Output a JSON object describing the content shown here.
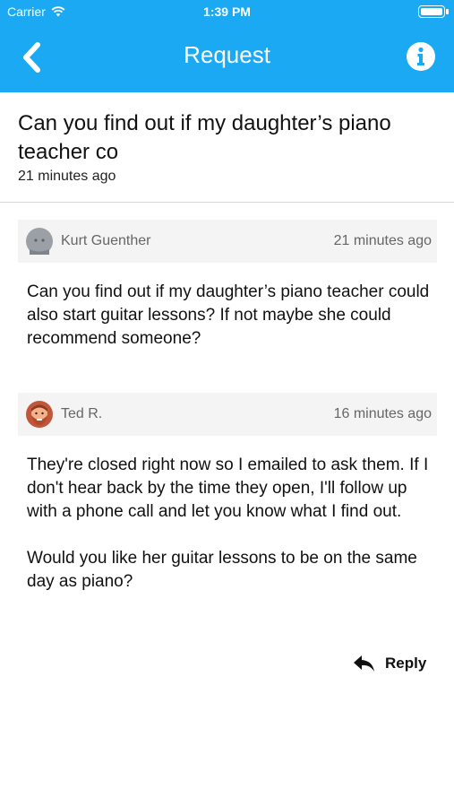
{
  "status_bar": {
    "carrier": "Carrier",
    "time": "1:39 PM"
  },
  "nav": {
    "title": "Request"
  },
  "request": {
    "title": "Can you find out if my daughter’s piano teacher co",
    "time": "21 minutes ago"
  },
  "messages": [
    {
      "author": "Kurt Guenther",
      "time": "21 minutes ago",
      "body": [
        "Can you find out if my daughter’s piano teacher could also start guitar lessons? If not maybe she could recommend someone?"
      ]
    },
    {
      "author": "Ted R.",
      "time": "16 minutes ago",
      "body": [
        "They're closed right now so I emailed to ask them. If I don't hear back by the time they open, I'll follow up with a phone call and let you know what I find out.",
        "Would you like her guitar lessons to be on the same day as piano?"
      ]
    }
  ],
  "actions": {
    "reply_label": "Reply"
  },
  "colors": {
    "accent": "#1aa9f2"
  }
}
